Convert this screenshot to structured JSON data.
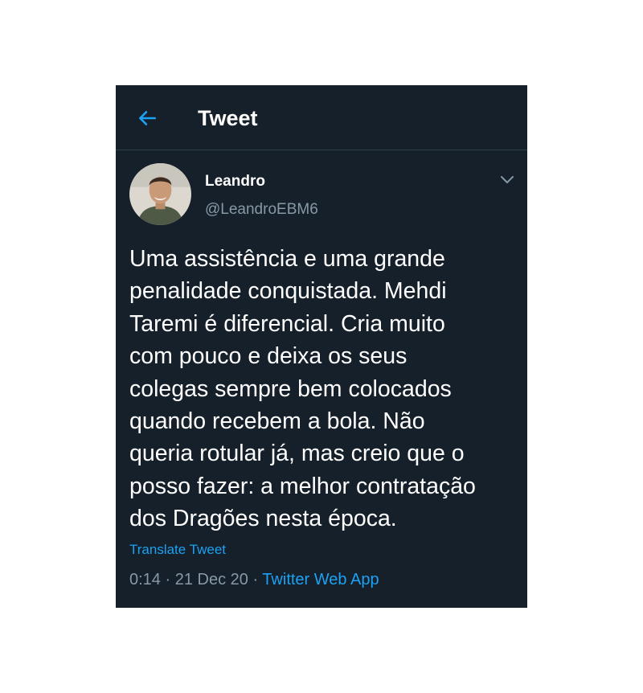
{
  "header": {
    "title": "Tweet",
    "back_icon": "arrow-left-icon"
  },
  "user": {
    "name": "Leandro",
    "handle": "@LeandroEBM6",
    "caret_icon": "chevron-down-icon"
  },
  "tweet": {
    "text": "Uma assistência e uma grande\npenalidade conquistada. Mehdi\nTaremi é diferencial. Cria muito\ncom pouco e deixa os seus\ncolegas sempre bem colocados\nquando recebem a bola. Não\nqueria rotular já, mas creio que o\nposso fazer: a melhor contratação\ndos Dragões nesta época.",
    "translate_label": "Translate Tweet",
    "time": "0:14",
    "separator": " · ",
    "date": "21 Dec 20",
    "source": "Twitter Web App"
  },
  "colors": {
    "background": "#15202b",
    "accent": "#1da1f2",
    "secondary_text": "#8899a6"
  }
}
